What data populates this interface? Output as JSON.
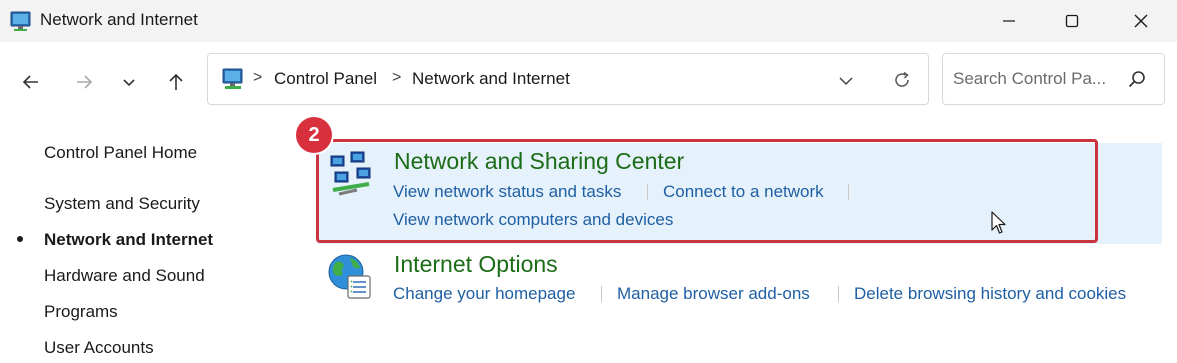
{
  "window": {
    "title": "Network and Internet",
    "controls": {
      "minimize": "minimize-icon",
      "maximize": "maximize-icon",
      "close": "close-icon"
    }
  },
  "nav": {
    "back": "arrow-left-icon",
    "forward": "arrow-right-icon",
    "recent": "chevron-down-icon",
    "up": "arrow-up-icon"
  },
  "address": {
    "crumbs": [
      "Control Panel",
      "Network and Internet"
    ],
    "separator": ">"
  },
  "search": {
    "placeholder": "Search Control Pa..."
  },
  "sidebar": {
    "home": "Control Panel Home",
    "items": [
      {
        "label": "System and Security",
        "active": false
      },
      {
        "label": "Network and Internet",
        "active": true
      },
      {
        "label": "Hardware and Sound",
        "active": false
      },
      {
        "label": "Programs",
        "active": false
      },
      {
        "label": "User Accounts",
        "active": false
      }
    ]
  },
  "annotation": {
    "step": "2",
    "color": "#d8303c"
  },
  "categories": [
    {
      "title": "Network and Sharing Center",
      "icon": "network-icon",
      "tasks": [
        "View network status and tasks",
        "Connect to a network",
        "View network computers and devices"
      ],
      "highlighted": true
    },
    {
      "title": "Internet Options",
      "icon": "globe-icon",
      "tasks": [
        "Change your homepage",
        "Manage browser add-ons",
        "Delete browsing history and cookies"
      ],
      "highlighted": false
    }
  ],
  "colors": {
    "category_title": "#1b6b17",
    "link": "#1f5fa3",
    "highlight_bg": "#e5f1fb",
    "outline": "#c9343f"
  }
}
